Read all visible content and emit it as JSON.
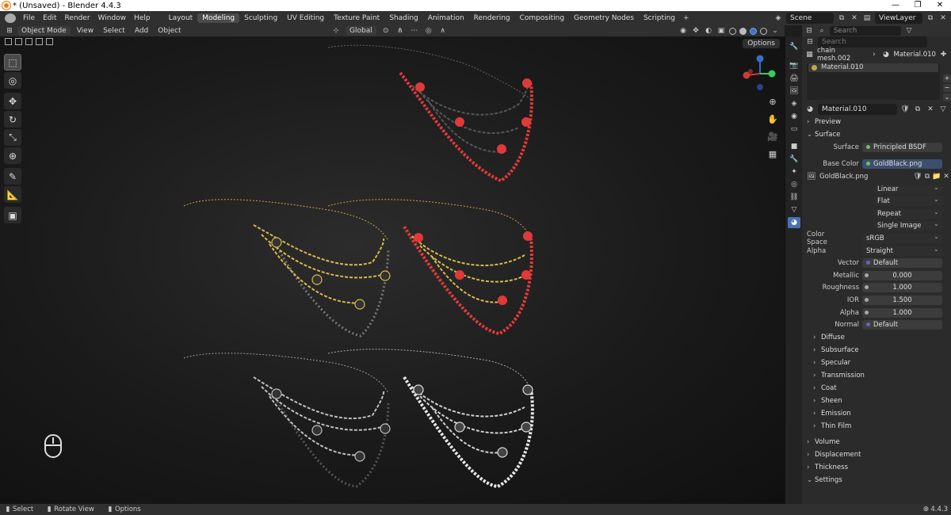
{
  "titlebar": {
    "title": "* (Unsaved) - Blender 4.4.3",
    "minimize": "—",
    "maximize": "❐",
    "close": "✕"
  },
  "menu": [
    "File",
    "Edit",
    "Render",
    "Window",
    "Help"
  ],
  "workspaces": [
    "Layout",
    "Modeling",
    "Sculpting",
    "UV Editing",
    "Texture Paint",
    "Shading",
    "Animation",
    "Rendering",
    "Compositing",
    "Geometry Nodes",
    "Scripting"
  ],
  "active_workspace": "Modeling",
  "add_workspace": "+",
  "scene": {
    "scene_name": "Scene",
    "view_layer": "ViewLayer"
  },
  "viewport_header": {
    "mode": "Object Mode",
    "menus": [
      "View",
      "Select",
      "Add",
      "Object"
    ],
    "orientation": "Global",
    "options": "Options"
  },
  "tools": [
    "select-box",
    "cursor",
    "move",
    "rotate",
    "scale",
    "transform",
    "annotate",
    "measure",
    "add-cube"
  ],
  "properties": {
    "search_placeholder": "Search",
    "breadcrumb": {
      "object": "chain mesh.002",
      "material": "Material.010"
    },
    "material_slot": "Material.010",
    "material_name": "Material.010",
    "sections": {
      "preview": "Preview",
      "surface": "Surface",
      "volume": "Volume",
      "displacement": "Displacement",
      "thickness": "Thickness",
      "settings": "Settings"
    },
    "surface": {
      "label": "Surface",
      "value": "Principled BSDF"
    },
    "base_color": {
      "label": "Base Color",
      "value": "GoldBlack.png"
    },
    "image": {
      "name": "GoldBlack.png",
      "interpolation": "Linear",
      "projection": "Flat",
      "extension": "Repeat",
      "source": "Single Image"
    },
    "color_space": {
      "label": "Color Space",
      "value": "sRGB"
    },
    "alpha_mode": {
      "label": "Alpha",
      "value": "Straight"
    },
    "vector": {
      "label": "Vector",
      "value": "Default"
    },
    "metallic": {
      "label": "Metallic",
      "value": "0.000"
    },
    "roughness": {
      "label": "Roughness",
      "value": "1.000"
    },
    "ior": {
      "label": "IOR",
      "value": "1.500"
    },
    "alpha": {
      "label": "Alpha",
      "value": "1.000"
    },
    "normal": {
      "label": "Normal",
      "value": "Default"
    },
    "subpanels": [
      "Diffuse",
      "Subsurface",
      "Specular",
      "Transmission",
      "Coat",
      "Sheen",
      "Emission",
      "Thin Film"
    ]
  },
  "statusbar": {
    "select": "Select",
    "rotate": "Rotate View",
    "options": "Options",
    "version": "4.4.3"
  },
  "colors": {
    "accent": "#4772b3",
    "red_beads": "#e0393a",
    "gold_chain": "#d9b84a",
    "silver_chain": "#bfbfbf",
    "black_beads": "#555555",
    "white_pearls": "#e8e8e8"
  }
}
